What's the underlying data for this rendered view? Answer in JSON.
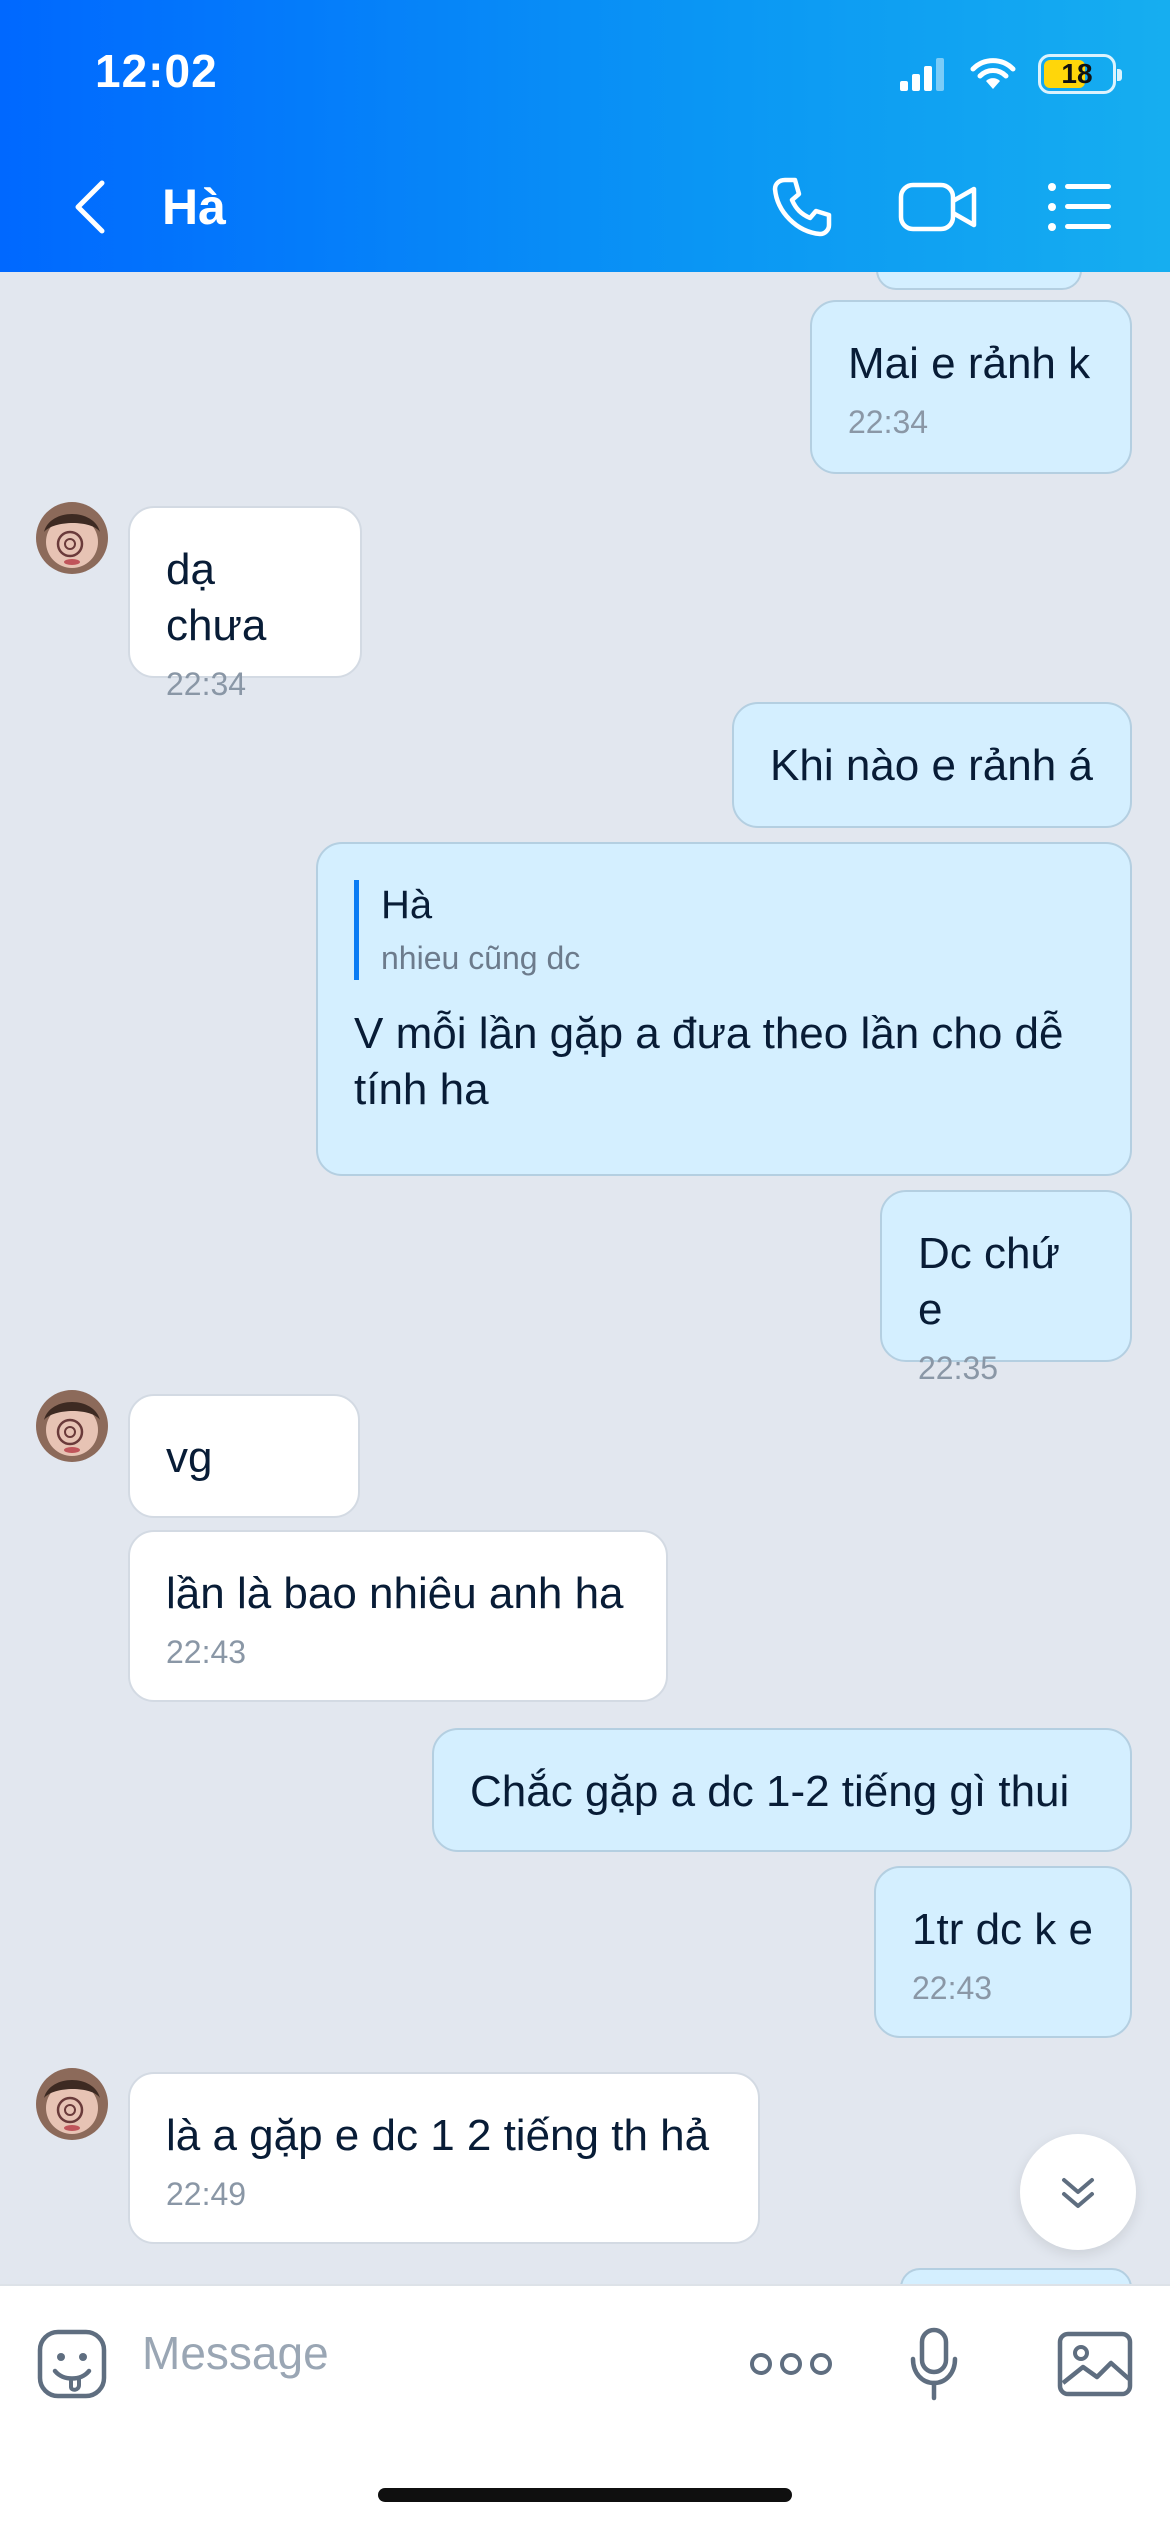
{
  "status_bar": {
    "time": "12:02",
    "battery": "18"
  },
  "header": {
    "title": "Hà"
  },
  "messages": [
    {
      "text": "Mai e rảnh k",
      "time": "22:34"
    },
    {
      "text": "dạ chưa",
      "time": "22:34"
    },
    {
      "text": "Khi nào e rảnh á"
    },
    {
      "reply_name": "Hà",
      "reply_text": "nhieu cũng dc",
      "text": "V mỗi lần gặp a đưa theo lần cho dễ tính ha"
    },
    {
      "text": "Dc chứ e",
      "time": "22:35"
    },
    {
      "text": "vg"
    },
    {
      "text": "lần là bao nhiêu anh ha",
      "time": "22:43"
    },
    {
      "text": "Chắc gặp a dc 1-2 tiếng gì thui"
    },
    {
      "text": "1tr dc k e",
      "time": "22:43"
    },
    {
      "text": "là a gặp e dc 1 2 tiếng th hả",
      "time": "22:49"
    }
  ],
  "input": {
    "placeholder": "Message"
  }
}
